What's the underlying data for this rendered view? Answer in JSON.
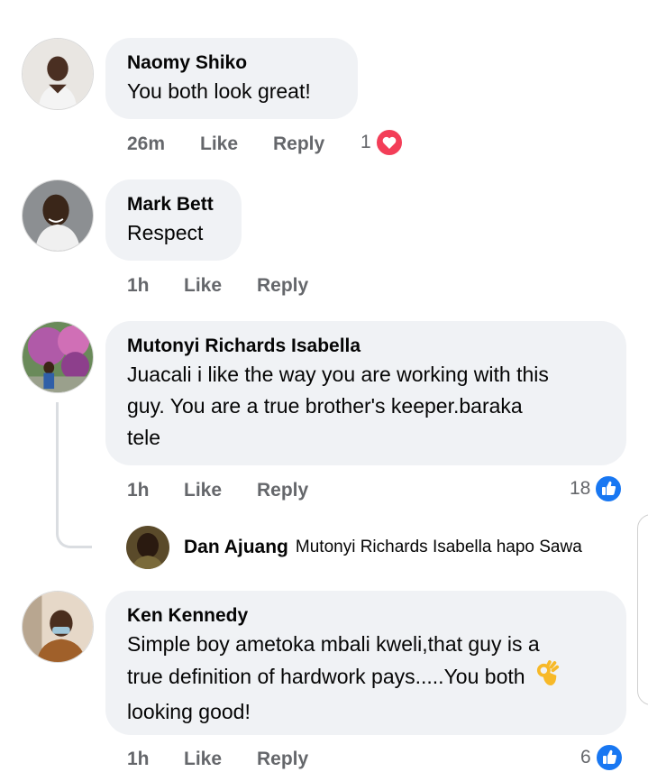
{
  "comments": [
    {
      "name": "Naomy Shiko",
      "text": "You both look great!",
      "time": "26m",
      "like": "Like",
      "reply": "Reply",
      "reaction_count": "1",
      "reaction_icon": "heart-icon"
    },
    {
      "name": "Mark Bett",
      "text": "Respect",
      "time": "1h",
      "like": "Like",
      "reply": "Reply"
    },
    {
      "name": "Mutonyi Richards Isabella",
      "text_lines": [
        "Juacali i like the way you are working  with this",
        "guy. You are a true brother's keeper.baraka",
        "tele"
      ],
      "time": "1h",
      "like": "Like",
      "reply": "Reply",
      "reaction_count": "18",
      "reaction_icon": "thumbs-up-icon",
      "reply_preview": {
        "name": "Dan Ajuang",
        "text": "Mutonyi Richards Isabella hapo Sawa"
      }
    },
    {
      "name": "Ken Kennedy",
      "text_lines": [
        "Simple boy ametoka mbali kweli,that guy is a",
        "true definition of hardwork pays.....You both",
        "looking good!"
      ],
      "emoji": "ok-hand-emoji",
      "time": "1h",
      "like": "Like",
      "reply": "Reply",
      "reaction_count": "6",
      "reaction_icon": "thumbs-up-icon"
    }
  ],
  "colors": {
    "bubble": "#f0f2f5",
    "meta": "#65676b",
    "like_blue": "#1877f2",
    "heart_red": "#f33e58"
  }
}
